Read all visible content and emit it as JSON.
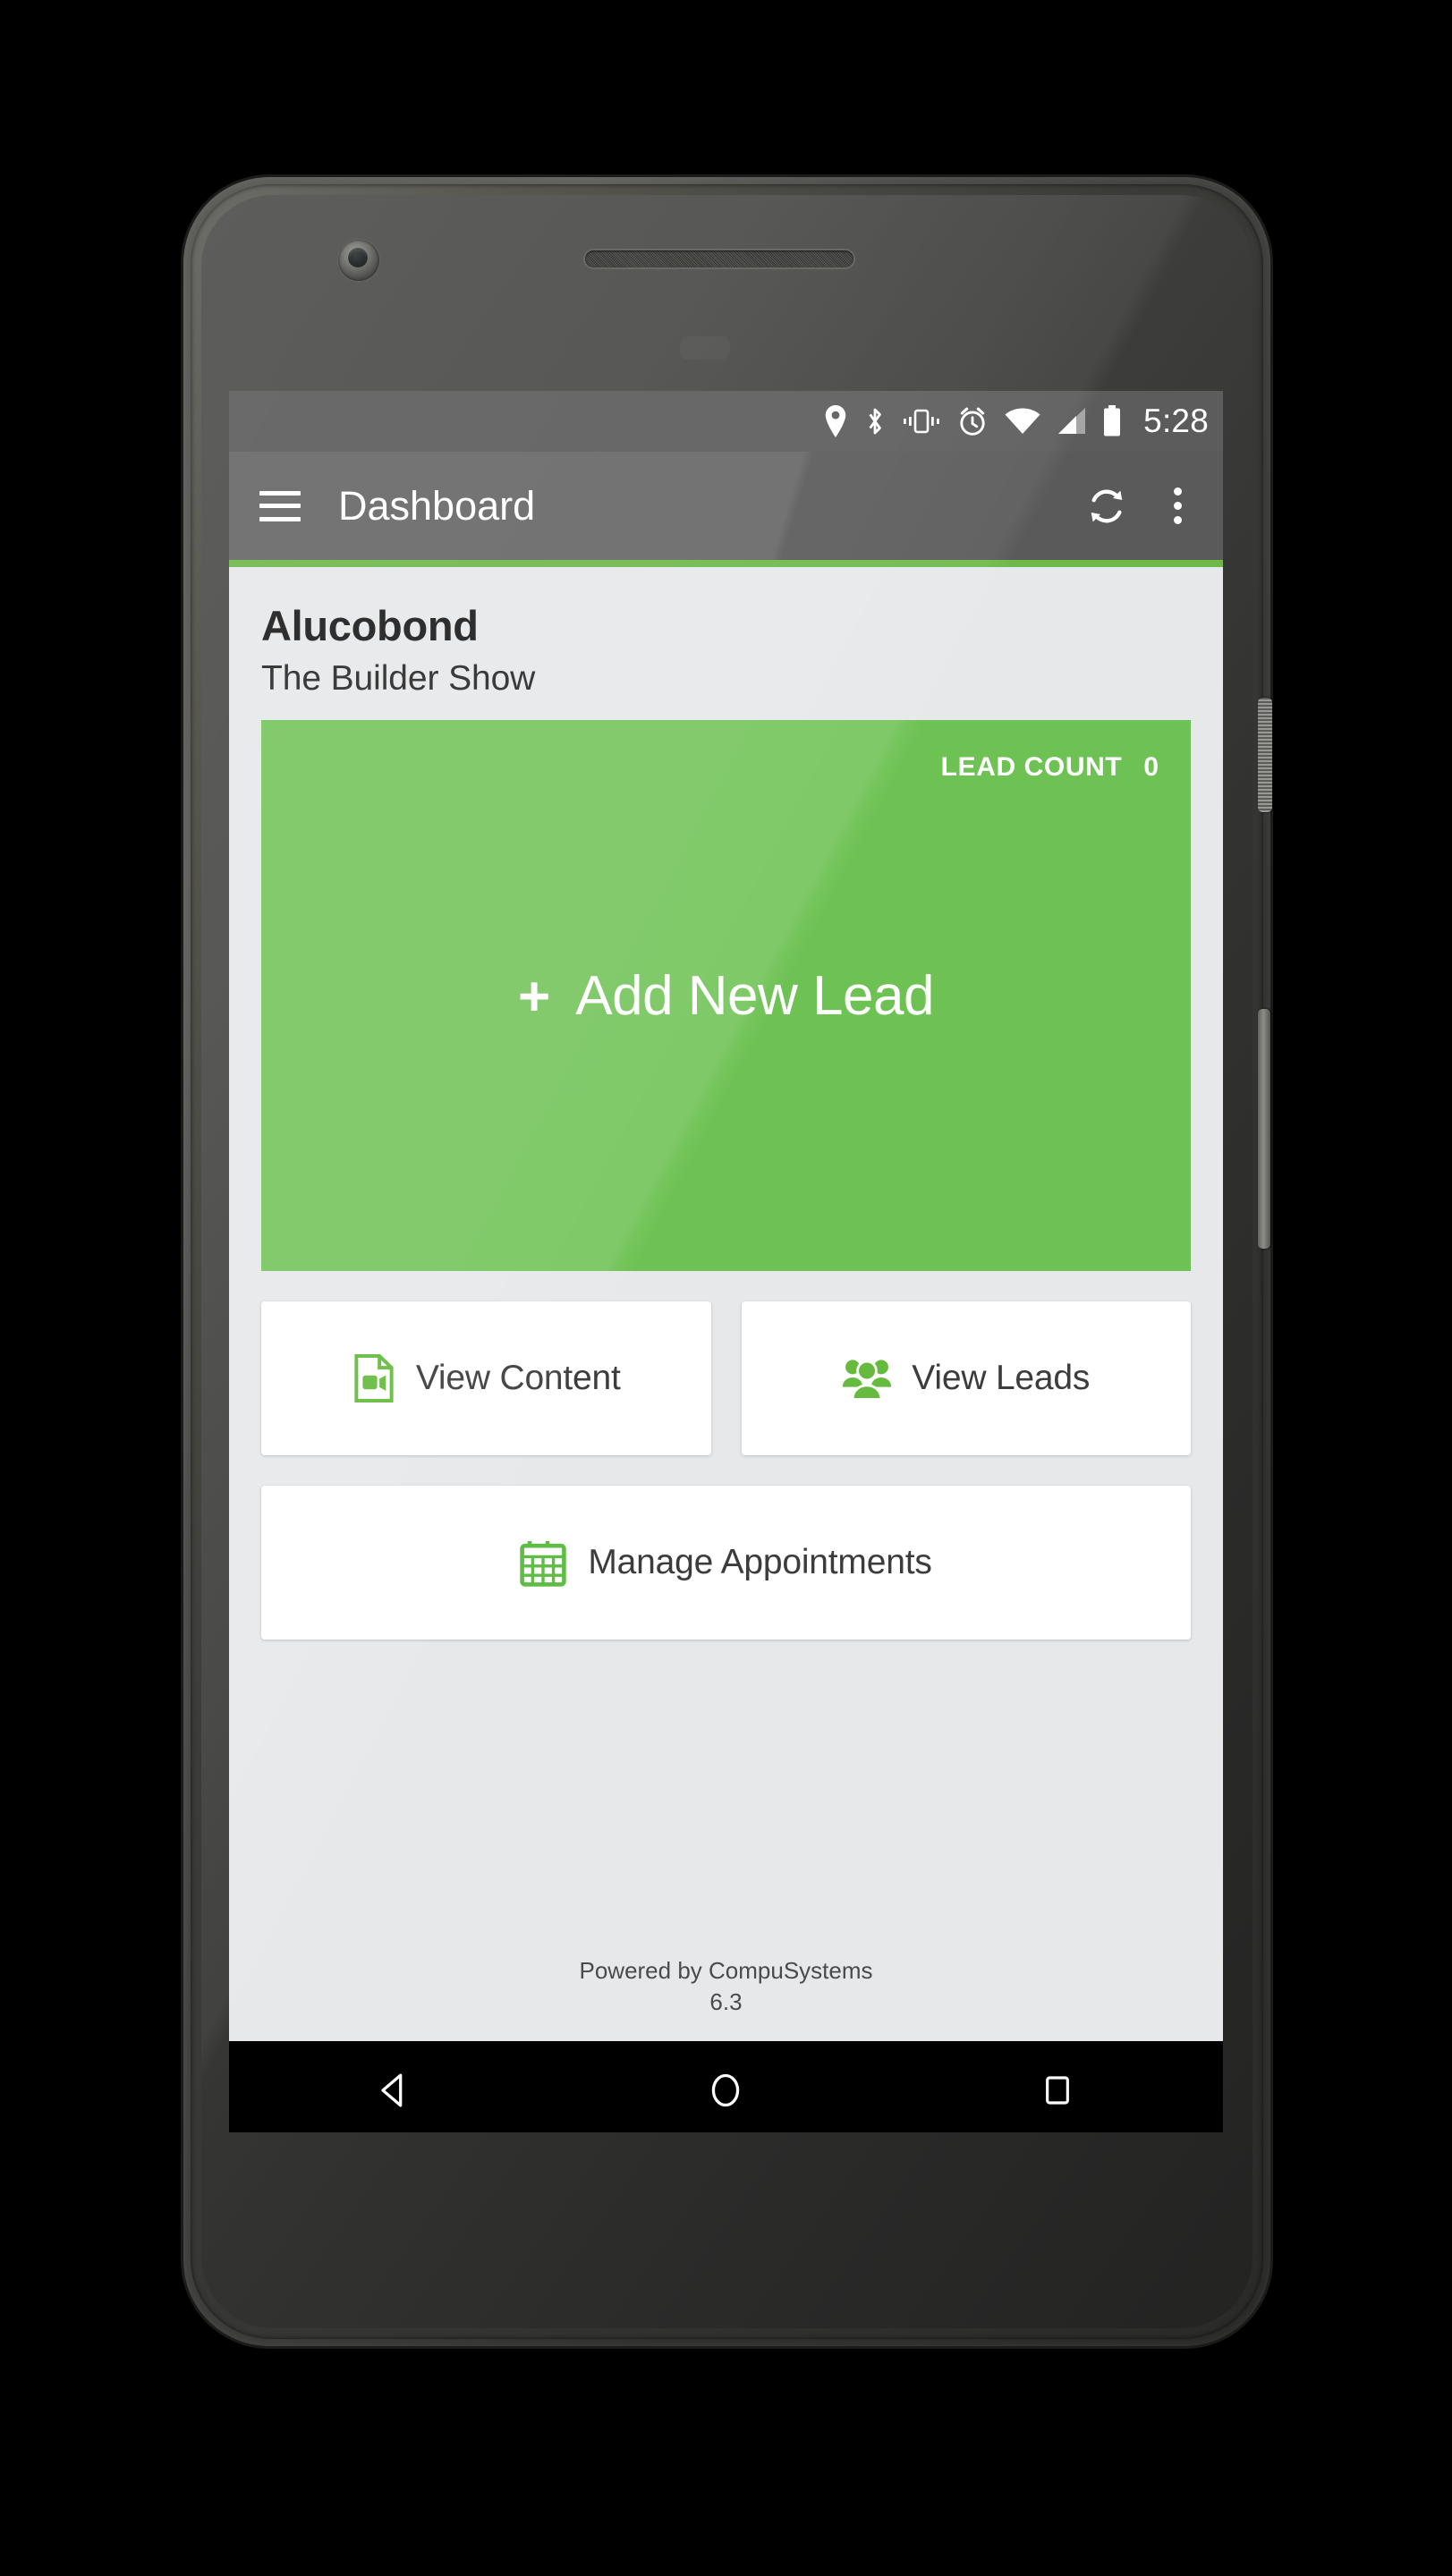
{
  "device": {
    "frame": "android-phone",
    "hardware": {
      "front_camera": "front-camera",
      "earpiece": "earpiece-speaker",
      "power_button": "power-button",
      "volume_button": "volume-rocker"
    }
  },
  "statusbar": {
    "icons": [
      {
        "name": "location-icon"
      },
      {
        "name": "bluetooth-icon"
      },
      {
        "name": "vibrate-icon"
      },
      {
        "name": "alarm-icon"
      },
      {
        "name": "wifi-icon"
      },
      {
        "name": "cellular-signal-icon"
      },
      {
        "name": "battery-icon"
      }
    ],
    "time": "5:28",
    "background_color": "#5c5c5c"
  },
  "appbar": {
    "menu_icon": "hamburger-menu-icon",
    "title": "Dashboard",
    "refresh_icon": "refresh-sync-icon",
    "overflow_icon": "overflow-menu-icon",
    "background_color": "#616161",
    "accent_color": "#6eb94a"
  },
  "header": {
    "company": "Alucobond",
    "event": "The Builder Show"
  },
  "lead_card": {
    "count_label": "LEAD COUNT",
    "count_value": "0",
    "plus": "+",
    "action_label": "Add New Lead",
    "background_color": "#6ec254"
  },
  "tiles": [
    {
      "id": "view-content",
      "label": "View Content",
      "icon": "document-video-icon",
      "icon_color": "#66bb3f"
    },
    {
      "id": "view-leads",
      "label": "View Leads",
      "icon": "people-group-icon",
      "icon_color": "#66bb3f"
    },
    {
      "id": "manage-appointments",
      "label": "Manage Appointments",
      "icon": "calendar-icon",
      "icon_color": "#5fbd45"
    }
  ],
  "footer": {
    "powered_by": "Powered by CompuSystems",
    "version": "6.3"
  },
  "navbar": {
    "back": "back-nav-icon",
    "home": "home-nav-icon",
    "recents": "recents-nav-icon"
  }
}
